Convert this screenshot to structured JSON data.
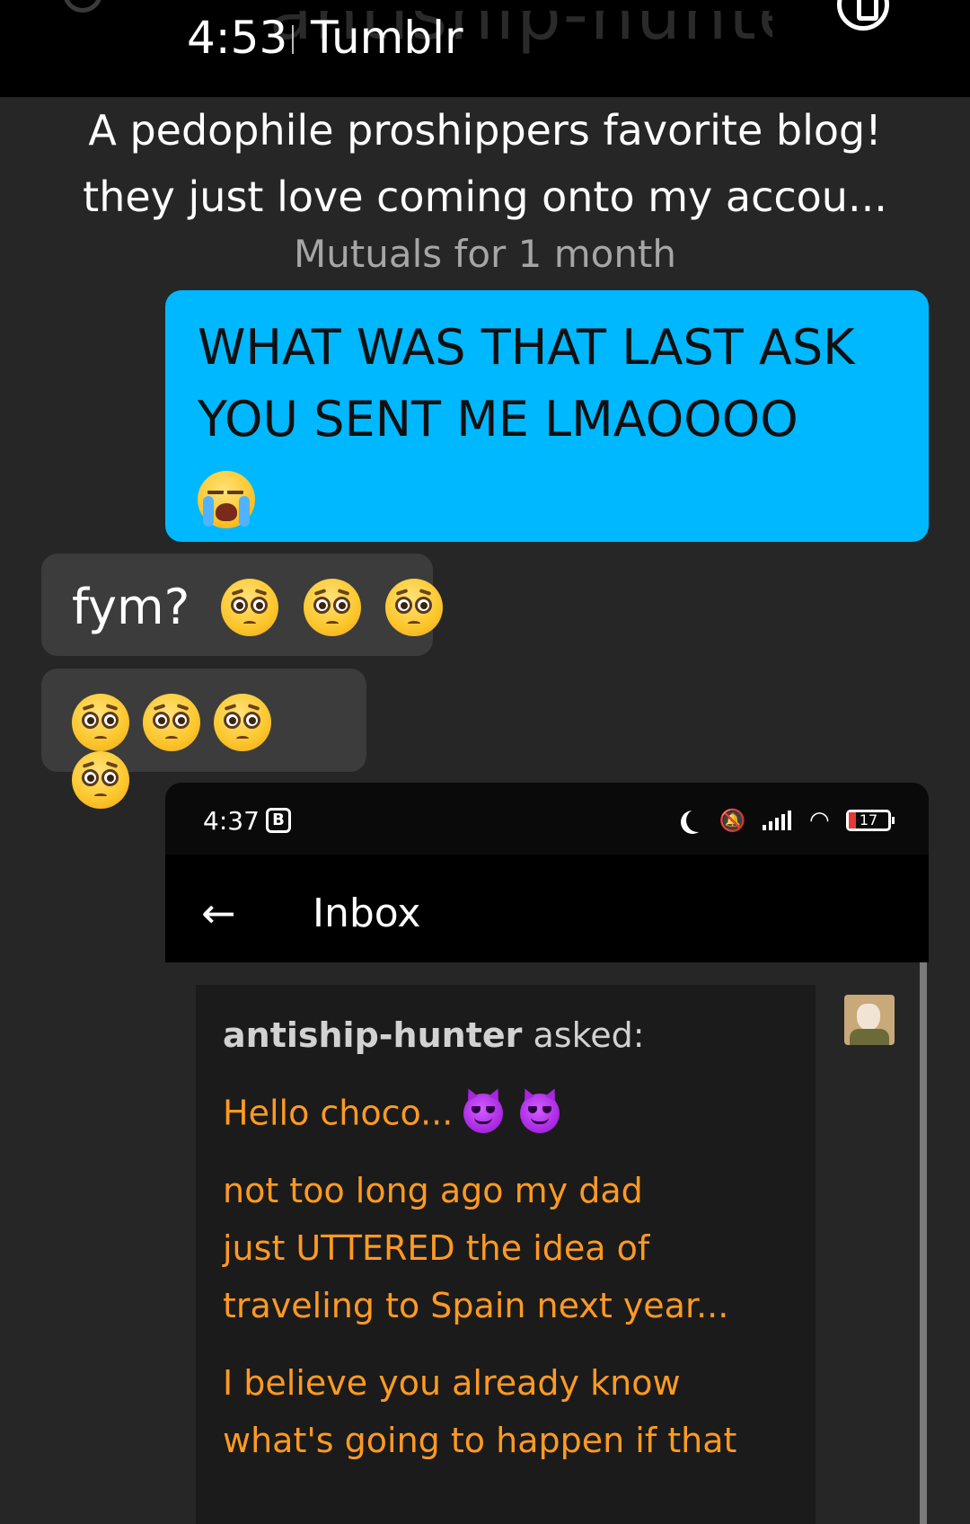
{
  "status_bar": {
    "time": "4:53",
    "app": "Tumblr",
    "ghost_title": "antiship-hunter"
  },
  "header": {
    "bio_line1": "A pedophile proshippers favorite blog!",
    "bio_line2": "they just love coming onto my accou...",
    "mutuals": "Mutuals for 1 month"
  },
  "messages": [
    {
      "side": "sent",
      "line1": "WHAT WAS THAT LAST ASK",
      "line2": "YOU SENT ME LMAOOOO",
      "emoji": "loudly-crying-face"
    },
    {
      "side": "received",
      "text": "fym?",
      "emoji": "pleading-face",
      "emoji_count": 3
    },
    {
      "side": "received",
      "text": "",
      "emoji": "pleading-face",
      "emoji_count": 4
    }
  ],
  "embedded_screenshot": {
    "status": {
      "time": "4:37",
      "badge": "B",
      "battery": "17"
    },
    "nav": {
      "title": "Inbox"
    },
    "ask": {
      "asker": "antiship-hunter",
      "asked_label": "asked:",
      "greeting": "Hello choco...",
      "greeting_emoji": "smiling-face-with-horns",
      "para1_line1": "not too long ago my dad",
      "para1_line2": "just UTTERED the idea of",
      "para1_line3": "traveling to Spain next year...",
      "para2_line1": "I believe you already know",
      "para2_line2": "what's going to happen if that"
    },
    "text_color": "#ff9a22"
  },
  "colors": {
    "background": "#262626",
    "sent_bubble": "#00b8ff",
    "received_bubble": "#3c3c3c"
  }
}
